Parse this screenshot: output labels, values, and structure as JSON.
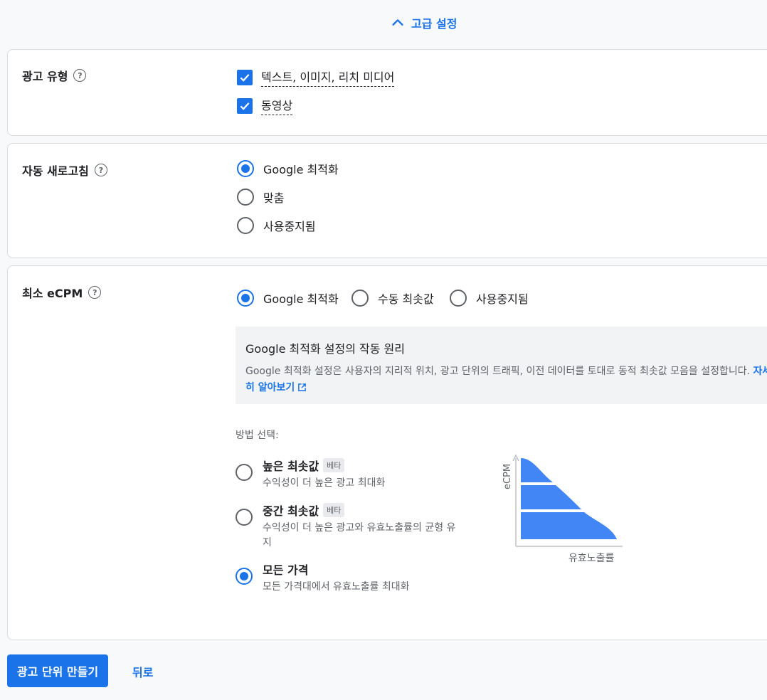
{
  "advanced": {
    "label": "고급 설정"
  },
  "ad_type": {
    "title": "광고 유형",
    "options": [
      {
        "label": "텍스트, 이미지, 리치 미디어",
        "checked": true
      },
      {
        "label": "동영상",
        "checked": true
      }
    ]
  },
  "auto_refresh": {
    "title": "자동 새로고침",
    "options": [
      {
        "label": "Google 최적화",
        "selected": true
      },
      {
        "label": "맞춤",
        "selected": false
      },
      {
        "label": "사용중지됨",
        "selected": false
      }
    ]
  },
  "min_ecpm": {
    "title": "최소 eCPM",
    "options": [
      {
        "label": "Google 최적화",
        "selected": true
      },
      {
        "label": "수동 최솟값",
        "selected": false
      },
      {
        "label": "사용중지됨",
        "selected": false
      }
    ],
    "info": {
      "title": "Google 최적화 설정의 작동 원리",
      "body": "Google 최적화 설정은 사용자의 지리적 위치, 광고 단위의 트래픽, 이전 데이터를 토대로 동적 최솟값 모음을 설정합니다.",
      "link": "자세히 알아보기"
    },
    "method_label": "방법 선택:",
    "methods": [
      {
        "title": "높은 최솟값",
        "badge": "베타",
        "desc": "수익성이 더 높은 광고 최대화",
        "selected": false
      },
      {
        "title": "중간 최솟값",
        "badge": "베타",
        "desc": "수익성이 더 높은 광고와 유효노출률의 균형 유지",
        "selected": false
      },
      {
        "title": "모든 가격",
        "badge": "",
        "desc": "모든 가격대에서 유효노출률 최대화",
        "selected": true
      }
    ],
    "chart": {
      "ylabel": "eCPM",
      "xlabel": "유효노출률"
    }
  },
  "footer": {
    "create_label": "광고 단위 만들기",
    "back_label": "뒤로"
  },
  "colors": {
    "accent": "#1a73e8",
    "chart_fill": "#4285f4"
  }
}
